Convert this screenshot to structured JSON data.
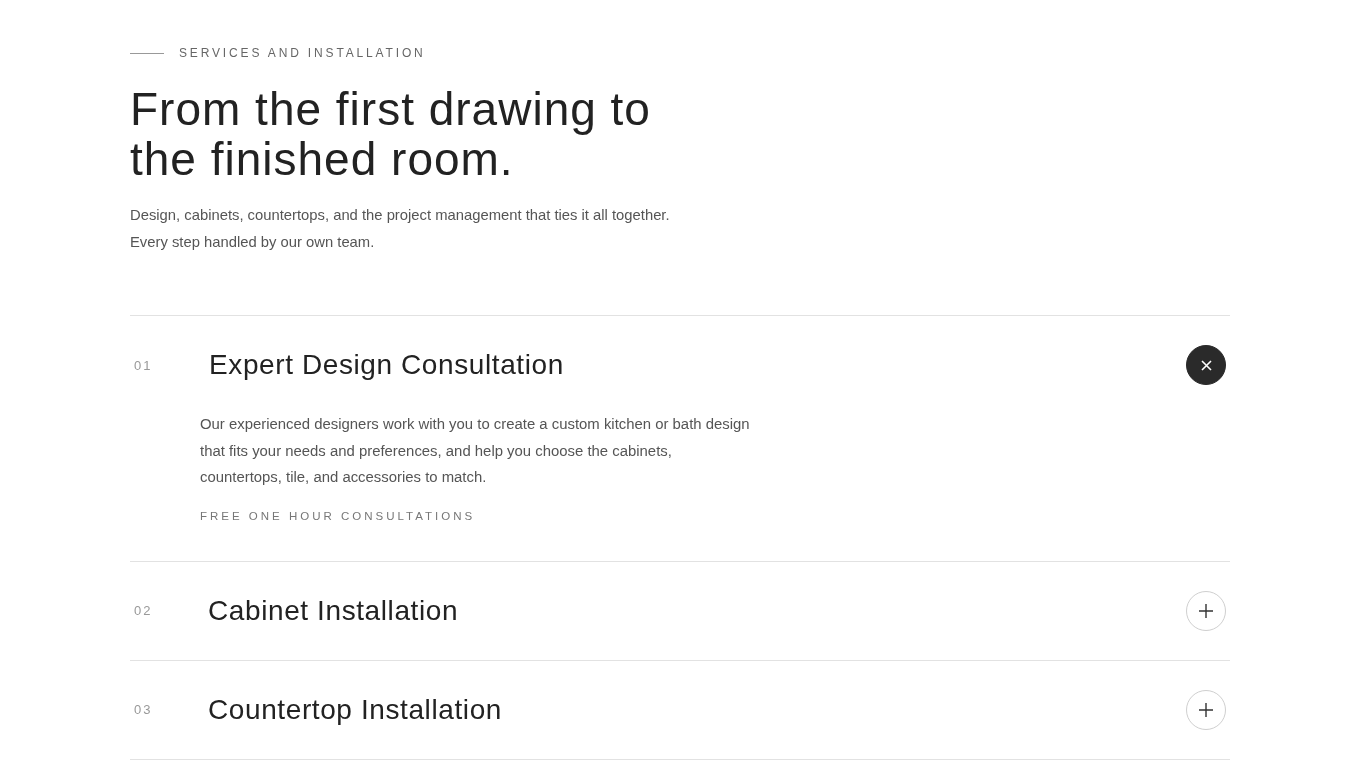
{
  "eyebrow": "SERVICES AND INSTALLATION",
  "heading": "From the first drawing to the finished room.",
  "intro": "Design, cabinets, countertops, and the project management that ties it all together. Every step handled by our own team.",
  "services": [
    {
      "number": "01",
      "title": "Expert Design Consultation",
      "expanded": true,
      "description": "Our experienced designers work with you to create a custom kitchen or bath design that fits your needs and preferences, and help you choose the cabinets, countertops, tile, and accessories to match.",
      "tag": "FREE ONE HOUR CONSULTATIONS"
    },
    {
      "number": "02",
      "title": "Cabinet Installation",
      "expanded": false
    },
    {
      "number": "03",
      "title": "Countertop Installation",
      "expanded": false
    }
  ]
}
